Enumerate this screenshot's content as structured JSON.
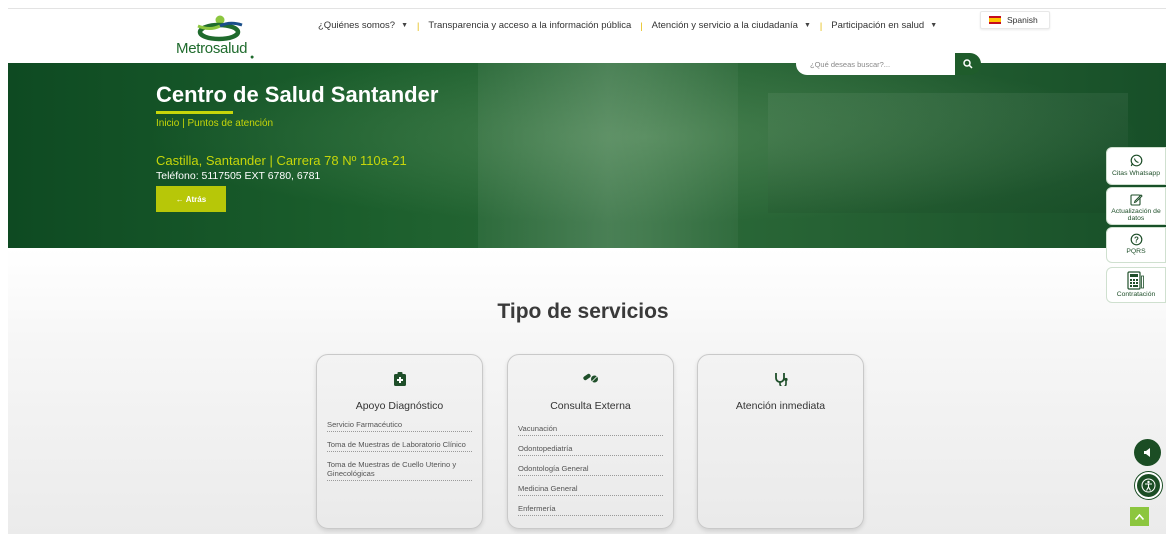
{
  "header": {
    "logo_text": "Metrosalud",
    "nav": [
      {
        "label": "¿Quiénes somos?",
        "has_dropdown": true
      },
      {
        "label": "Transparencia y acceso a la información pública",
        "has_dropdown": false
      },
      {
        "label": "Atención y servicio a la ciudadanía",
        "has_dropdown": true
      },
      {
        "label": "Participación en salud",
        "has_dropdown": true
      }
    ],
    "language": "Spanish",
    "search_placeholder": "¿Qué deseas buscar?..."
  },
  "hero": {
    "title": "Centro de Salud Santander",
    "breadcrumb": "Inicio | Puntos de atención",
    "address": "Castilla, Santander | Carrera 78 Nº 110a-21",
    "phone": "Teléfono: 5117505 EXT 6780, 6781",
    "back_label": "← Atrás"
  },
  "services": {
    "title": "Tipo de servicios",
    "cards": [
      {
        "title": "Apoyo Diagnóstico",
        "icon": "clipboard-plus-icon",
        "items": [
          "Servicio Farmacéutico",
          "Toma de Muestras de Laboratorio Clínico",
          "Toma de Muestras de Cuello Uterino y Ginecológicas"
        ]
      },
      {
        "title": "Consulta Externa",
        "icon": "pills-icon",
        "items": [
          "Vacunación",
          "Odontopediatría",
          "Odontología General",
          "Medicina General",
          "Enfermería"
        ]
      },
      {
        "title": "Atención inmediata",
        "icon": "stethoscope-icon",
        "items": []
      }
    ]
  },
  "sidebar": [
    {
      "label": "Citas Whatsapp",
      "icon": "whatsapp-icon"
    },
    {
      "label": "Actualización de datos",
      "icon": "edit-icon"
    },
    {
      "label": "PQRS",
      "icon": "question-icon"
    },
    {
      "label": "Contratación",
      "icon": "calculator-icon"
    }
  ],
  "colors": {
    "primary_green": "#1f5c2b",
    "accent_lime": "#c6d60a",
    "button_lime": "#b7c708"
  }
}
